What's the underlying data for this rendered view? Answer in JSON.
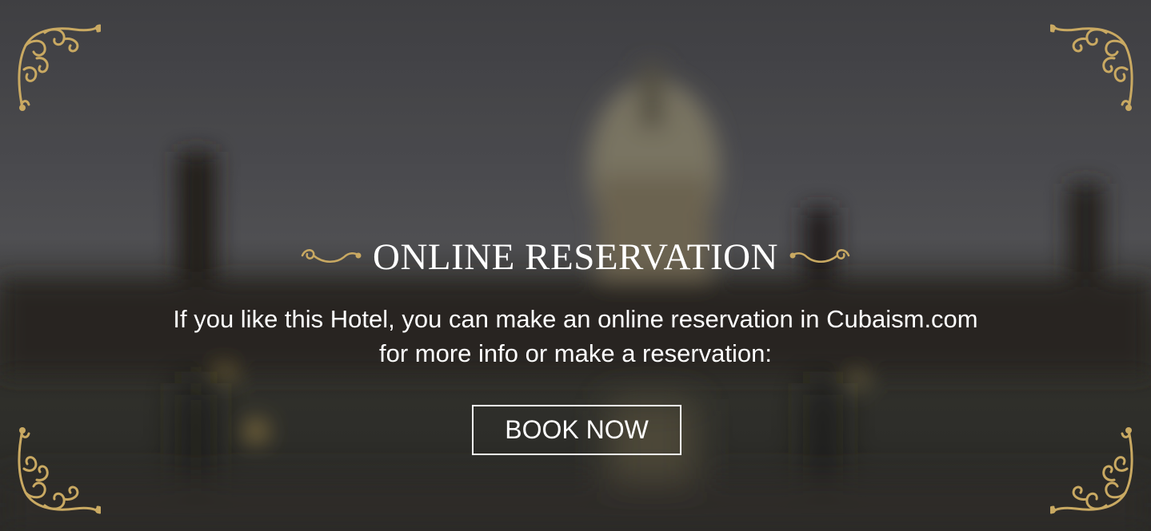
{
  "section": {
    "title": "ONLINE RESERVATION",
    "description_line1": "If you like this Hotel, you can make an online reservation in Cubaism.com",
    "description_line2": "for more info or make a reservation:",
    "button_label": "BOOK NOW"
  },
  "colors": {
    "gold": "#c9a962",
    "text": "#ffffff",
    "overlay": "#3d3d40"
  },
  "icons": {
    "corner": "ornamental-corner-icon",
    "flourish": "scroll-flourish-icon"
  }
}
